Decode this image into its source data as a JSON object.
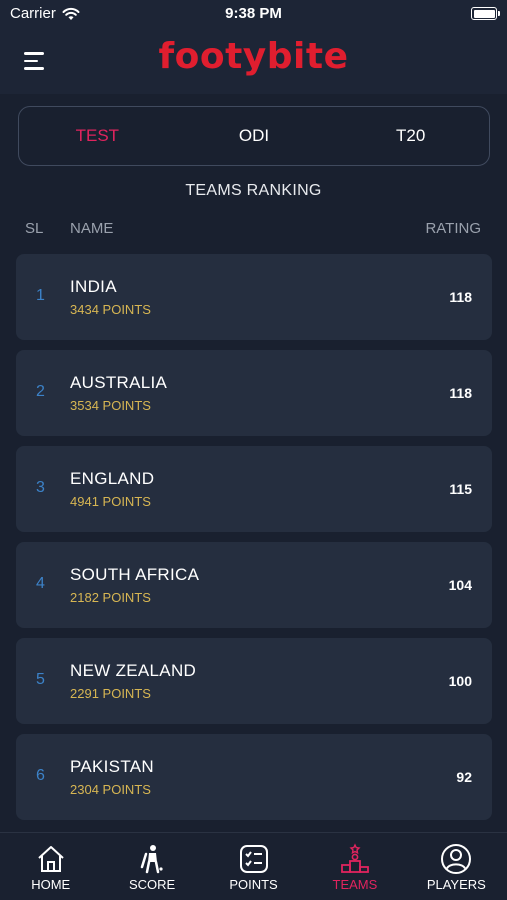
{
  "status_bar": {
    "carrier": "Carrier",
    "time": "9:38 PM"
  },
  "header": {
    "logo": "footybite"
  },
  "tabs": [
    {
      "label": "TEST",
      "active": true
    },
    {
      "label": "ODI",
      "active": false
    },
    {
      "label": "T20",
      "active": false
    }
  ],
  "section_title": "TEAMS RANKING",
  "columns": {
    "sl": "SL",
    "name": "NAME",
    "rating": "RATING"
  },
  "teams": [
    {
      "rank": "1",
      "name": "INDIA",
      "points": "3434 POINTS",
      "rating": "118"
    },
    {
      "rank": "2",
      "name": "AUSTRALIA",
      "points": "3534 POINTS",
      "rating": "118"
    },
    {
      "rank": "3",
      "name": "ENGLAND",
      "points": "4941 POINTS",
      "rating": "115"
    },
    {
      "rank": "4",
      "name": "SOUTH AFRICA",
      "points": "2182 POINTS",
      "rating": "104"
    },
    {
      "rank": "5",
      "name": "NEW ZEALAND",
      "points": "2291 POINTS",
      "rating": "100"
    },
    {
      "rank": "6",
      "name": "PAKISTAN",
      "points": "2304 POINTS",
      "rating": "92"
    }
  ],
  "nav": [
    {
      "label": "HOME",
      "icon": "home-icon",
      "active": false
    },
    {
      "label": "SCORE",
      "icon": "cricket-player-icon",
      "active": false
    },
    {
      "label": "POINTS",
      "icon": "points-table-icon",
      "active": false
    },
    {
      "label": "TEAMS",
      "icon": "trophy-podium-icon",
      "active": true
    },
    {
      "label": "PLAYERS",
      "icon": "user-icon",
      "active": false
    }
  ],
  "colors": {
    "accent": "#e0245e",
    "logo": "#e01e2f",
    "rank": "#3c82c8",
    "points": "#d7b653",
    "background": "#19202f",
    "card": "#252e3f"
  }
}
